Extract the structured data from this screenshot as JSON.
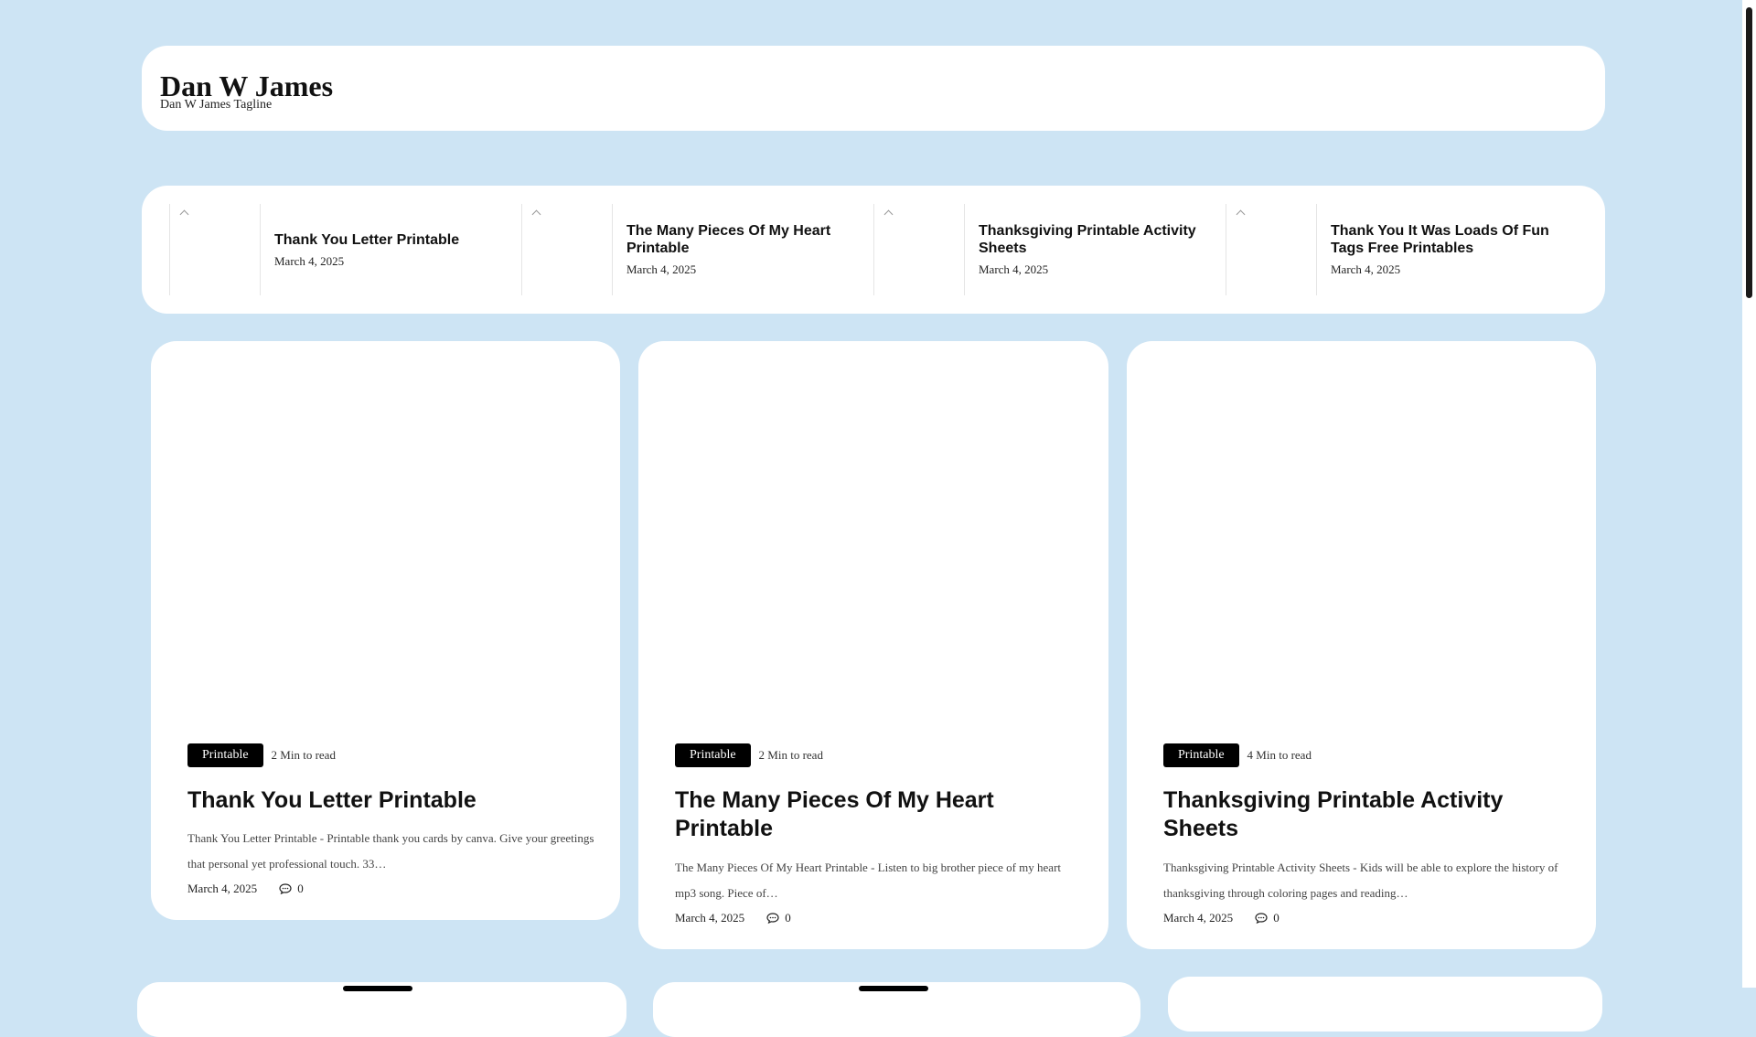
{
  "site": {
    "title": "Dan W James",
    "tagline": "Dan W James Tagline"
  },
  "ticker": [
    {
      "title": "Thank You Letter Printable",
      "date": "March 4, 2025"
    },
    {
      "title": "The Many Pieces Of My Heart Printable",
      "date": "March 4, 2025"
    },
    {
      "title": "Thanksgiving Printable Activity Sheets",
      "date": "March 4, 2025"
    },
    {
      "title": "Thank You It Was Loads Of Fun Tags Free Printables",
      "date": "March 4, 2025"
    }
  ],
  "posts": [
    {
      "category": "Printable",
      "read_num": "2",
      "read_label": "Min to read",
      "title": "Thank You Letter Printable",
      "excerpt": "Thank You Letter Printable - Printable thank you cards by canva. Give your greetings that personal yet professional touch. 33…",
      "date": "March 4, 2025",
      "comments": "0"
    },
    {
      "category": "Printable",
      "read_num": "2",
      "read_label": "Min to read",
      "title": "The Many Pieces Of My Heart Printable",
      "excerpt": "The Many Pieces Of My Heart Printable - Listen to big brother piece of my heart mp3 song. Piece of…",
      "date": "March 4, 2025",
      "comments": "0"
    },
    {
      "category": "Printable",
      "read_num": "4",
      "read_label": "Min to read",
      "title": "Thanksgiving Printable Activity Sheets",
      "excerpt": "Thanksgiving Printable Activity Sheets - Kids will be able to explore the history of thanksgiving through coloring pages and reading…",
      "date": "March 4, 2025",
      "comments": "0"
    }
  ],
  "icons": {
    "comment": "comment-icon",
    "broken_image": "broken-image-icon"
  },
  "colors": {
    "background": "#cde4f4",
    "card": "#ffffff",
    "badge": "#000000"
  }
}
